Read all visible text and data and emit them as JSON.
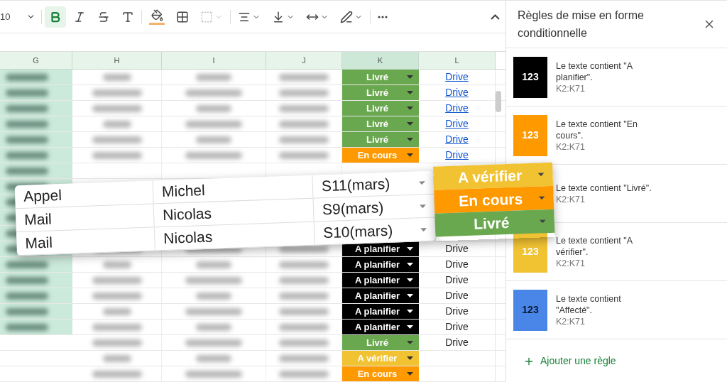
{
  "toolbar": {
    "font_size": "10",
    "bold": true
  },
  "columns": [
    {
      "label": "G",
      "selected": false
    },
    {
      "label": "H",
      "selected": false
    },
    {
      "label": "I",
      "selected": false
    },
    {
      "label": "J",
      "selected": false
    },
    {
      "label": "K",
      "selected": true
    },
    {
      "label": "L",
      "selected": false
    }
  ],
  "rows": [
    {
      "status": {
        "label": "Livré",
        "color": "#6aa84f"
      },
      "drive": {
        "text": "Drive",
        "kind": "link"
      }
    },
    {
      "status": {
        "label": "Livré",
        "color": "#6aa84f"
      },
      "drive": {
        "text": "Drive",
        "kind": "link"
      }
    },
    {
      "status": {
        "label": "Livré",
        "color": "#6aa84f"
      },
      "drive": {
        "text": "Drive",
        "kind": "link"
      }
    },
    {
      "status": {
        "label": "Livré",
        "color": "#6aa84f"
      },
      "drive": {
        "text": "Drive",
        "kind": "link"
      }
    },
    {
      "status": {
        "label": "Livré",
        "color": "#6aa84f"
      },
      "drive": {
        "text": "Drive",
        "kind": "link"
      }
    },
    {
      "status": {
        "label": "En cours",
        "color": "#ff9900"
      },
      "drive": {
        "text": "Drive",
        "kind": "link"
      }
    },
    {},
    {},
    {},
    {},
    {},
    {
      "status": {
        "label": "A planifier",
        "color": "#000000"
      },
      "drive": {
        "text": "Drive",
        "kind": "plain"
      }
    },
    {
      "status": {
        "label": "A planifier",
        "color": "#000000"
      },
      "drive": {
        "text": "Drive",
        "kind": "plain"
      }
    },
    {
      "status": {
        "label": "A planifier",
        "color": "#000000"
      },
      "drive": {
        "text": "Drive",
        "kind": "plain"
      }
    },
    {
      "status": {
        "label": "A planifier",
        "color": "#000000"
      },
      "drive": {
        "text": "Drive",
        "kind": "plain"
      }
    },
    {
      "status": {
        "label": "A planifier",
        "color": "#000000"
      },
      "drive": {
        "text": "Drive",
        "kind": "plain"
      }
    },
    {
      "status": {
        "label": "A planifier",
        "color": "#000000"
      },
      "drive": {
        "text": "Drive",
        "kind": "plain"
      }
    },
    {
      "status": {
        "label": "Livré",
        "color": "#6aa84f"
      },
      "drive": {
        "text": "Drive",
        "kind": "plain"
      }
    },
    {
      "status": {
        "label": "A vérifier",
        "color": "#f1c232"
      }
    },
    {
      "status": {
        "label": "En cours",
        "color": "#ff9900"
      }
    }
  ],
  "callout": {
    "rows": [
      {
        "cells": [
          "Appel",
          "Michel",
          "S11(mars)"
        ],
        "status": {
          "label": "A vérifier",
          "color": "#f1c232"
        }
      },
      {
        "cells": [
          "Mail",
          "Nicolas",
          "S9(mars)"
        ],
        "status": {
          "label": "En cours",
          "color": "#ff9900"
        }
      },
      {
        "cells": [
          "Mail",
          "Nicolas",
          "S10(mars)"
        ],
        "status": {
          "label": "Livré",
          "color": "#6aa84f"
        }
      }
    ]
  },
  "panel": {
    "title": "Règles de mise en forme conditionnelle",
    "rules": [
      {
        "text": "Le texte contient \"A planifier\".",
        "range": "K2:K71",
        "sample": "123",
        "color": "#000000",
        "dark_text": false
      },
      {
        "text": "Le texte contient \"En cours\".",
        "range": "K2:K71",
        "sample": "123",
        "color": "#ff9900",
        "dark_text": false
      },
      {
        "text": "Le texte contient \"Livré\".",
        "range": "K2:K71"
      },
      {
        "text": "Le texte contient \"A vérifier\".",
        "range": "K2:K71",
        "sample": "123",
        "color": "#f1c232",
        "dark_text": false
      },
      {
        "text": "Le texte contient \"Affecté\".",
        "range": "K2:K71",
        "sample": "123",
        "color": "#4a86e8",
        "dark_text": true
      }
    ],
    "add_button": "Ajouter une règle"
  }
}
